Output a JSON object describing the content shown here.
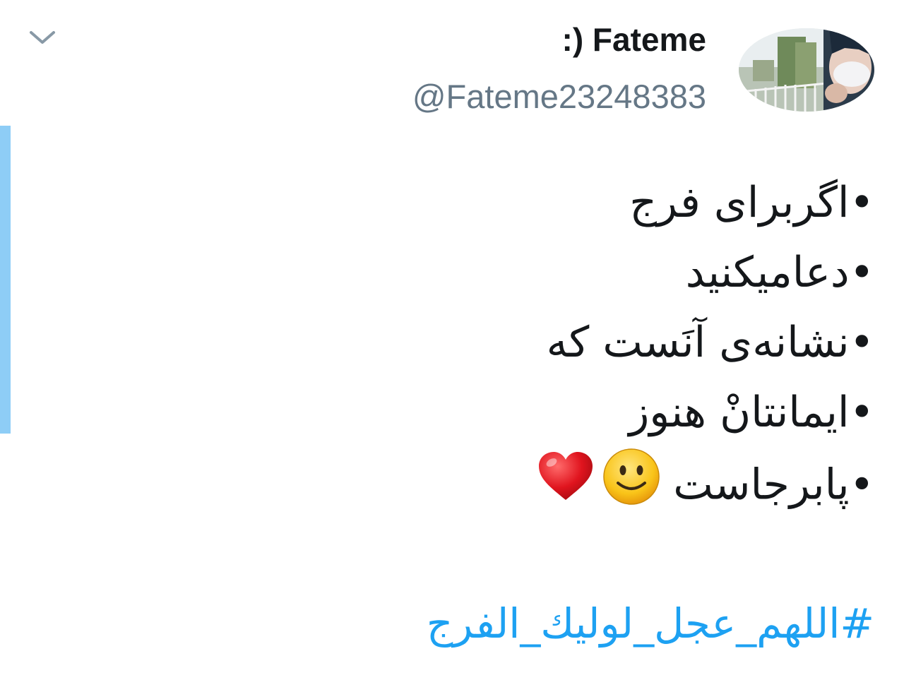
{
  "tweet": {
    "display_name": ":) Fateme",
    "handle": "@Fateme23248383",
    "lines": [
      "•اگربرای فرج",
      "•دعامیکنید",
      "•نشانه‌ی آنَست که",
      "•ایمانتانْ هنوز",
      "•پابرجاست"
    ],
    "hashtag": "#اللهم_عجل_لوليك_الفرج"
  },
  "icons": {
    "menu": "chevron-down-icon",
    "smile": "slightly-smiling-face-emoji",
    "heart": "red-heart-emoji"
  },
  "colors": {
    "accent_bar": "#8ecdf6",
    "hashtag": "#1da1f2",
    "handle": "#657786",
    "name": "#14171a"
  }
}
